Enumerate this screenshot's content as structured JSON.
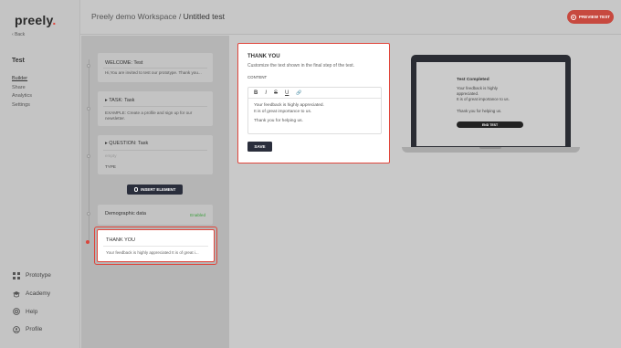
{
  "app": {
    "logo": "preely",
    "back_label": "Back",
    "project_title": "Test"
  },
  "nav": {
    "builder": "Builder",
    "share": "Share",
    "analytics": "Analytics",
    "settings": "Settings"
  },
  "bottom_nav": {
    "prototype": "Prototype",
    "academy": "Academy",
    "help": "Help",
    "profile": "Profile"
  },
  "header": {
    "workspace": "Preely demo Workspace",
    "separator": "/",
    "test_name": "Untitled test",
    "preview_label": "PREVIEW TEST"
  },
  "builder": {
    "welcome": {
      "title": "WELCOME:  Test",
      "body": "Hi,You are invited to test our prototype. Thank you..."
    },
    "task": {
      "title": "TASK:  Task",
      "body": "EXAMPLE: Create a profile and sign up for our newsletter."
    },
    "question": {
      "title": "QUESTION:  Task",
      "placeholder": "empty",
      "type_label": "TYPE"
    },
    "insert_label": "INSERT ELEMENT",
    "demographic": {
      "title": "Demographic data",
      "status": "Enabled"
    },
    "thank_you": {
      "title": "THANK YOU",
      "body": "Your feedback is highly appreciated It is of great i..."
    }
  },
  "editor": {
    "title": "THANK YOU",
    "subtitle": "Customize the text shown in the final step of the test.",
    "content_label": "CONTENT",
    "toolbar": {
      "bold": "B",
      "italic": "I",
      "strike": "S",
      "underline": "U",
      "link": "🔗"
    },
    "text_line1": "Your feedback is highly appreciated.",
    "text_line2": "It is of great importance to us.",
    "text_line3": "Thank you for helping us.",
    "save_label": "SAVE"
  },
  "preview": {
    "title": "Test Completed",
    "line1": "Your feedback is highly",
    "line2": "appreciated.",
    "line3": "It is of great importance to us.",
    "line4": "Thank you for helping us.",
    "end_label": "END TEST"
  },
  "colors": {
    "accent": "#e0463c",
    "dark_button": "#2a2e3c",
    "enabled": "#3a9d3a"
  }
}
